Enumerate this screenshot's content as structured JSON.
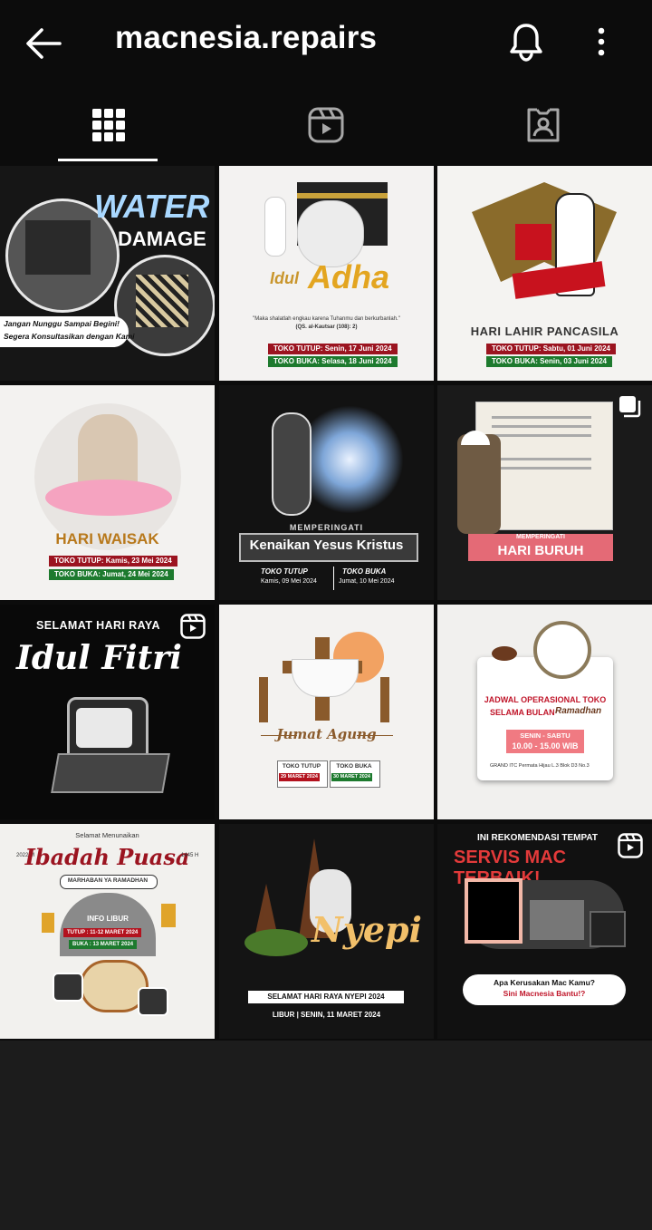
{
  "header": {
    "title": "macnesia.repairs"
  },
  "posts": [
    {
      "t1": "WATER",
      "t2": "DAMAGE",
      "t3": "Jangan Nunggu Sampai Begini!",
      "t4": "Segera Konsultasikan dengan Kami"
    },
    {
      "t1": "Idul",
      "t2": "Adha",
      "t3": "\"Maka shalatlah engkau karena Tuhanmu dan berkurbanlah.\"",
      "t4": "(QS. al-Kautsar (108): 2)",
      "t5": "TOKO TUTUP: Senin, 17 Juni 2024",
      "t6": "TOKO BUKA: Selasa, 18 Juni 2024"
    },
    {
      "t1": "HARI LAHIR PANCASILA",
      "t5": "TOKO TUTUP: Sabtu, 01 Juni 2024",
      "t6": "TOKO BUKA: Senin, 03 Juni 2024"
    },
    {
      "t1": "HARI WAISAK",
      "t5": "TOKO TUTUP: Kamis, 23 Mei 2024",
      "t6": "TOKO BUKA: Jumat, 24 Mei 2024"
    },
    {
      "t1": "MEMPERINGATI",
      "t2": "Kenaikan Yesus Kristus",
      "t5": "TOKO TUTUP",
      "t5b": "Kamis, 09 Mei 2024",
      "t6": "TOKO BUKA",
      "t6b": "Jumat, 10 Mei 2024"
    },
    {
      "t1": "MEMPERINGATI",
      "t2": "HARI BURUH"
    },
    {
      "t1": "SELAMAT HARI RAYA",
      "t2": "Idul Fitri"
    },
    {
      "t1": "Jumat Agung",
      "t5": "TOKO TUTUP",
      "t5b": "29 MARET 2024",
      "t6": "TOKO BUKA",
      "t6b": "30 MARET 2024"
    },
    {
      "t1": "JADWAL OPERASIONAL TOKO",
      "t2": "SELAMA BULAN",
      "t3": "Ramadhan",
      "t4": "SENIN - SABTU",
      "t5": "10.00 - 15.00 WIB",
      "t6": "GRAND ITC Permata Hijau L.3 Blok D3 No.3"
    },
    {
      "t0": "Selamat Menunaikan",
      "t1": "Ibadah Puasa",
      "t2": "MARHABAN YA RAMADHAN",
      "t3": "INFO LIBUR",
      "t4": "TUTUP : 11-12 MARET 2024",
      "t5": "BUKA : 13 MARET 2024",
      "ya": "2022 M",
      "yb": "1445 H"
    },
    {
      "t1": "Nyepi",
      "t2": "SELAMAT HARI RAYA NYEPI 2024",
      "t3": "LIBUR | SENIN, 11 MARET 2024"
    },
    {
      "t1": "INI REKOMENDASI TEMPAT",
      "t2": "SERVIS MAC TERBAIK!",
      "t3": "Apa Kerusakan Mac Kamu?",
      "t4": "Sini Macnesia Bantu!?"
    }
  ],
  "icons": [
    "arrow-left-icon",
    "bell-icon",
    "more-vertical-icon",
    "grid-icon",
    "reels-icon",
    "tagged-icon",
    "carousel-icon",
    "reel-badge-icon"
  ],
  "colors": {
    "bar": "#0c0c0c",
    "text": "#ffffff",
    "tab_inactive": "#a8a8a8",
    "accent_red": "#b3121e",
    "accent_green": "#1d7a2e"
  }
}
